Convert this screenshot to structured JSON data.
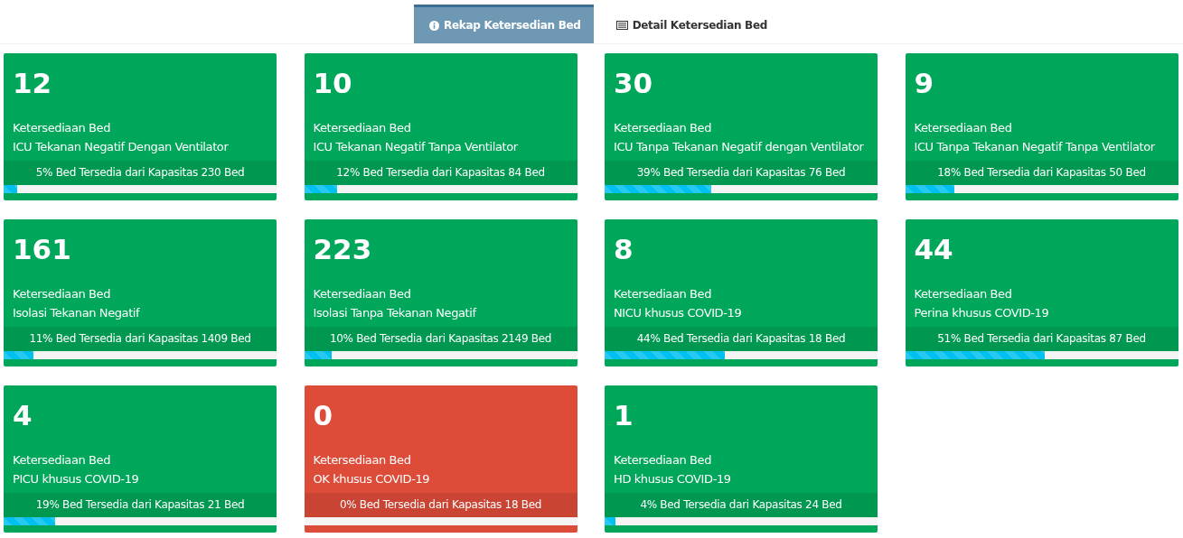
{
  "tabs": [
    {
      "label": "Rekap Ketersedian Bed",
      "kind": "info",
      "selected": true
    },
    {
      "label": "Detail Ketersedian Bed",
      "kind": "list",
      "selected": false
    }
  ],
  "cards": [
    {
      "count": "12",
      "title": "Ketersediaan Bed",
      "category": "ICU Tekanan Negatif Dengan Ventilator",
      "footer": "5% Bed Tersedia dari Kapasitas 230 Bed",
      "level": 0.05,
      "color": "#00a65a"
    },
    {
      "count": "10",
      "title": "Ketersediaan Bed",
      "category": "ICU Tekanan Negatif Tanpa Ventilator",
      "footer": "12% Bed Tersedia dari Kapasitas 84 Bed",
      "level": 0.12,
      "color": "#00a65a"
    },
    {
      "count": "30",
      "title": "Ketersediaan Bed",
      "category": "ICU Tanpa Tekanan Negatif dengan Ventilator",
      "footer": "39% Bed Tersedia dari Kapasitas 76 Bed",
      "level": 0.39,
      "color": "#00a65a"
    },
    {
      "count": "9",
      "title": "Ketersediaan Bed",
      "category": "ICU Tanpa Tekanan Negatif Tanpa Ventilator",
      "footer": "18% Bed Tersedia dari Kapasitas 50 Bed",
      "level": 0.18,
      "color": "#00a65a"
    },
    {
      "count": "161",
      "title": "Ketersediaan Bed",
      "category": "Isolasi Tekanan Negatif",
      "footer": "11% Bed Tersedia dari Kapasitas 1409 Bed",
      "level": 0.11,
      "color": "#00a65a"
    },
    {
      "count": "223",
      "title": "Ketersediaan Bed",
      "category": "Isolasi Tanpa Tekanan Negatif",
      "footer": "10% Bed Tersedia dari Kapasitas 2149 Bed",
      "level": 0.1,
      "color": "#00a65a"
    },
    {
      "count": "8",
      "title": "Ketersediaan Bed",
      "category": "NICU khusus COVID-19",
      "footer": "44% Bed Tersedia dari Kapasitas 18 Bed",
      "level": 0.44,
      "color": "#00a65a"
    },
    {
      "count": "44",
      "title": "Ketersediaan Bed",
      "category": "Perina khusus COVID-19",
      "footer": "51% Bed Tersedia dari Kapasitas 87 Bed",
      "level": 0.51,
      "color": "#00a65a"
    },
    {
      "count": "4",
      "title": "Ketersediaan Bed",
      "category": "PICU khusus COVID-19",
      "footer": "19% Bed Tersedia dari Kapasitas 21 Bed",
      "level": 0.19,
      "color": "#00a65a"
    },
    {
      "count": "0",
      "title": "Ketersediaan Bed",
      "category": "OK khusus COVID-19",
      "footer": "0% Bed Tersedia dari Kapasitas 18 Bed",
      "color": "#dd4b39"
    },
    {
      "count": "1",
      "title": "Ketersediaan Bed",
      "category": "HD khusus COVID-19",
      "footer": "4% Bed Tersedia dari Kapasitas 24 Bed",
      "level": 0.04,
      "color": "#00a65a"
    }
  ]
}
